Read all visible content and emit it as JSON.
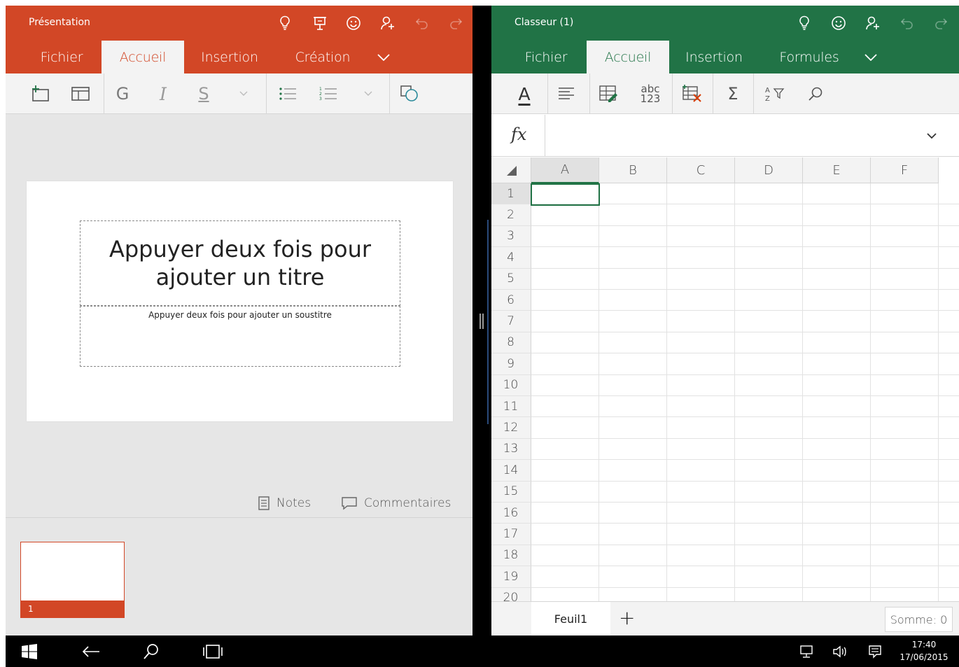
{
  "powerpoint": {
    "title": "Présentation",
    "accent": "#d24726",
    "tabs": [
      {
        "label": "Fichier"
      },
      {
        "label": "Accueil"
      },
      {
        "label": "Insertion"
      },
      {
        "label": "Création"
      }
    ],
    "active_tab": "Accueil",
    "titlebar_icons": [
      "lightbulb-icon",
      "presenter-icon",
      "smiley-icon",
      "share-person-icon",
      "undo-icon",
      "redo-icon"
    ],
    "ribbon": {
      "bold_label": "G",
      "italic_label": "I",
      "underline_label": "S"
    },
    "slide": {
      "title_placeholder": "Appuyer deux fois pour ajouter un titre",
      "subtitle_placeholder": "Appuyer deux fois pour ajouter un soustitre"
    },
    "notes_label": "Notes",
    "comments_label": "Commentaires",
    "thumbnail_number": "1"
  },
  "excel": {
    "title": "Classeur (1)",
    "accent": "#217346",
    "tabs": [
      {
        "label": "Fichier"
      },
      {
        "label": "Accueil"
      },
      {
        "label": "Insertion"
      },
      {
        "label": "Formules"
      }
    ],
    "active_tab": "Accueil",
    "ribbon": {
      "font_color_label": "A",
      "number_format_top": "abc",
      "number_format_bottom": "123",
      "sum_label": "Σ"
    },
    "formula_bar": {
      "fx_label": "fx",
      "value": ""
    },
    "columns": [
      "A",
      "B",
      "C",
      "D",
      "E",
      "F"
    ],
    "rows": [
      "1",
      "2",
      "3",
      "4",
      "5",
      "6",
      "7",
      "8",
      "9",
      "10",
      "11",
      "12",
      "13",
      "14",
      "15",
      "16",
      "17",
      "18",
      "19",
      "20"
    ],
    "active_cell": "A1",
    "sheet_tab": "Feuil1",
    "add_sheet_label": "+",
    "status_sum": "Somme: 0"
  },
  "taskbar": {
    "time": "17:40",
    "date": "17/06/2015"
  }
}
